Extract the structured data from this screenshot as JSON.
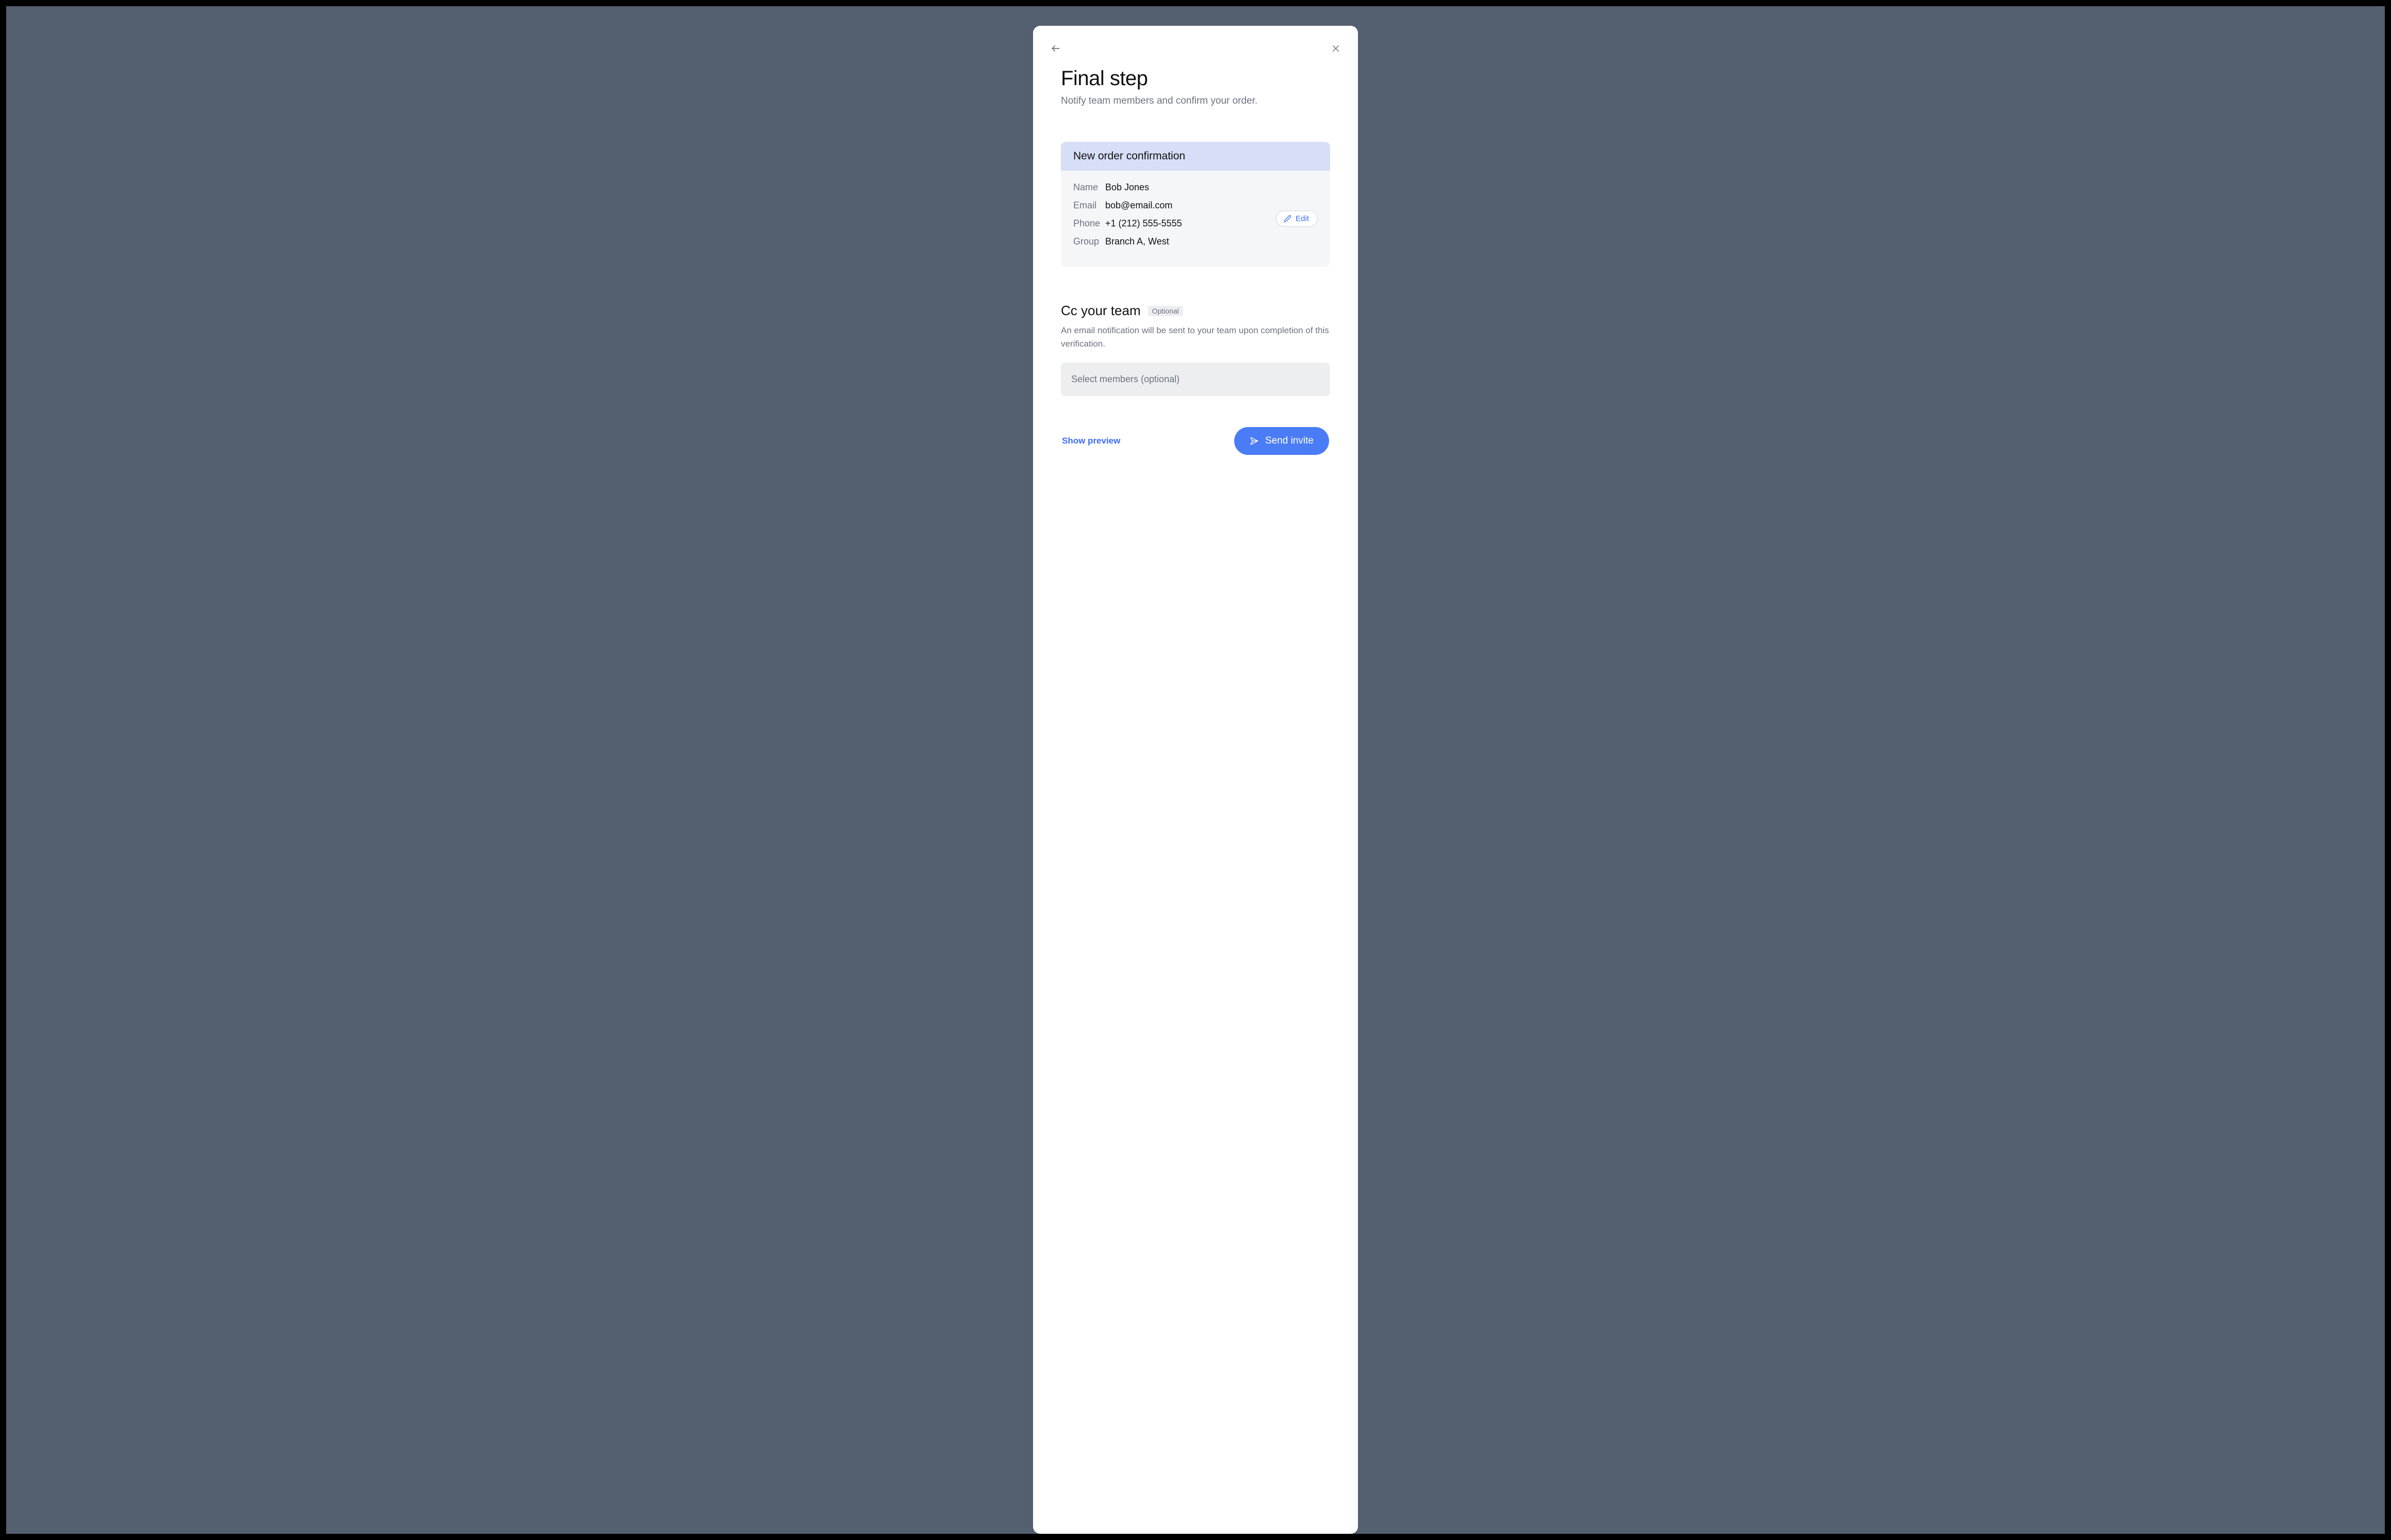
{
  "header": {
    "title": "Final step",
    "subtitle": "Notify team members and confirm your order."
  },
  "confirmation_card": {
    "header": "New order confirmation",
    "edit_label": "Edit",
    "fields": {
      "name_label": "Name",
      "name_value": "Bob Jones",
      "email_label": "Email",
      "email_value": "bob@email.com",
      "phone_label": "Phone",
      "phone_value": "+1 (212) 555-5555",
      "group_label": "Group",
      "group_value": "Branch A, West"
    }
  },
  "cc_section": {
    "title": "Cc your team",
    "optional_badge": "Optional",
    "description": "An email notification will be sent to your team upon completion of this verification.",
    "select_placeholder": "Select members (optional)"
  },
  "footer": {
    "show_preview_label": "Show preview",
    "send_invite_label": "Send invite"
  }
}
